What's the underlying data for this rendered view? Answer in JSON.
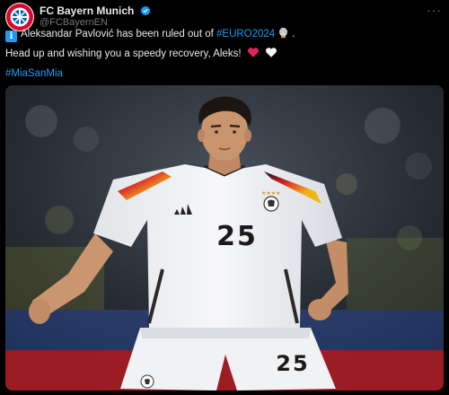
{
  "account": {
    "name": "FC Bayern Munich",
    "handle": "@FCBayernEN",
    "more": "···"
  },
  "tweet": {
    "info_badge": "i",
    "line1_text": "Aleksandar Pavlović has been ruled out of ",
    "line1_hashtag": "#EURO2024",
    "line1_end": ".",
    "line2_text": "Head up and wishing you a speedy recovery, Aleks!",
    "hashtag": "#MiaSanMia"
  },
  "photo": {
    "shirt_number": "25",
    "shorts_number": "25"
  },
  "colors": {
    "link": "#1d9bf0",
    "verified": "#1d9bf0",
    "heart_red": "#f91880",
    "background": "#000000"
  },
  "icons": [
    "verified-badge-icon",
    "info-icon",
    "euro-trophy-icon",
    "red-heart-icon",
    "white-heart-icon",
    "more-icon"
  ]
}
